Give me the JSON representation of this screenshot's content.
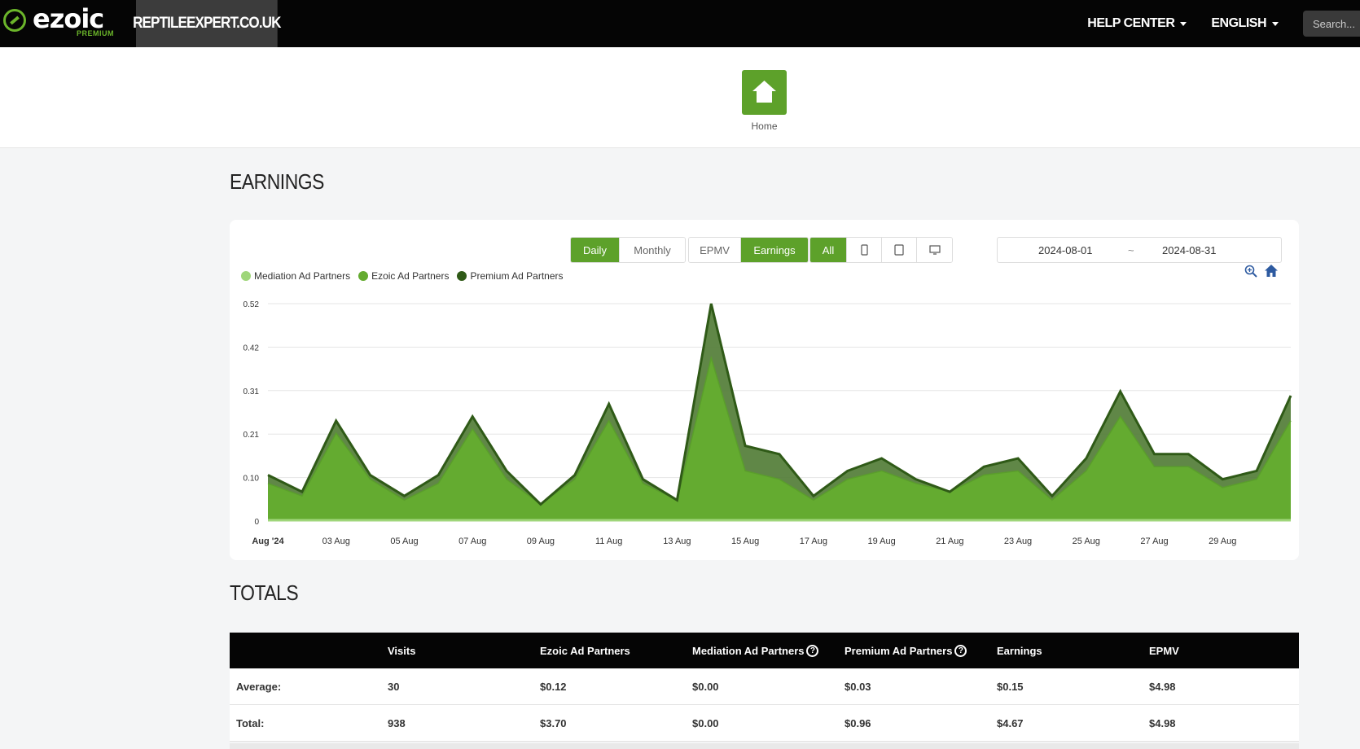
{
  "nav": {
    "logo_text": "ezoic",
    "logo_sub": "PREMIUM",
    "site": "REPTILEEXPERT.CO.UK",
    "help_center": "HELP CENTER",
    "language": "ENGLISH",
    "search_placeholder": "Search..."
  },
  "home": {
    "label": "Home"
  },
  "earnings": {
    "title": "EARNINGS",
    "period_buttons": [
      "Daily",
      "Monthly"
    ],
    "metric_buttons": [
      "EPMV",
      "Earnings"
    ],
    "device_all": "All",
    "device_icons": [
      "mobile-icon",
      "tablet-icon",
      "desktop-icon"
    ],
    "date_from": "2024-08-01",
    "date_sep": "~",
    "date_to": "2024-08-31"
  },
  "colors": {
    "accent": "#5da12a",
    "mediation": "#9fd67a",
    "ezoic": "#64ab30",
    "premium": "#3c6b21"
  },
  "chart_data": {
    "type": "area",
    "stacked": true,
    "x": [
      "Aug '24",
      "02 Aug",
      "03 Aug",
      "04 Aug",
      "05 Aug",
      "06 Aug",
      "07 Aug",
      "08 Aug",
      "09 Aug",
      "10 Aug",
      "11 Aug",
      "12 Aug",
      "13 Aug",
      "14 Aug",
      "15 Aug",
      "16 Aug",
      "17 Aug",
      "18 Aug",
      "19 Aug",
      "20 Aug",
      "21 Aug",
      "22 Aug",
      "23 Aug",
      "24 Aug",
      "25 Aug",
      "26 Aug",
      "27 Aug",
      "28 Aug",
      "29 Aug",
      "30 Aug",
      "31 Aug"
    ],
    "x_tick_labels": [
      "Aug '24",
      "03 Aug",
      "05 Aug",
      "07 Aug",
      "09 Aug",
      "11 Aug",
      "13 Aug",
      "15 Aug",
      "17 Aug",
      "19 Aug",
      "21 Aug",
      "23 Aug",
      "25 Aug",
      "27 Aug",
      "29 Aug"
    ],
    "y_tick_labels": [
      "0",
      "0.10",
      "0.21",
      "0.31",
      "0.42",
      "0.52"
    ],
    "ylim": [
      0,
      0.52
    ],
    "series": [
      {
        "name": "Mediation Ad Partners",
        "values": [
          0,
          0,
          0,
          0,
          0,
          0,
          0,
          0,
          0,
          0,
          0,
          0,
          0,
          0,
          0,
          0,
          0,
          0,
          0,
          0,
          0,
          0,
          0,
          0,
          0,
          0,
          0,
          0,
          0,
          0,
          0
        ]
      },
      {
        "name": "Ezoic Ad Partners",
        "values": [
          0.09,
          0.06,
          0.21,
          0.1,
          0.05,
          0.09,
          0.22,
          0.1,
          0.04,
          0.1,
          0.24,
          0.09,
          0.05,
          0.39,
          0.12,
          0.1,
          0.05,
          0.1,
          0.12,
          0.09,
          0.07,
          0.11,
          0.12,
          0.05,
          0.12,
          0.25,
          0.13,
          0.13,
          0.08,
          0.1,
          0.24
        ]
      },
      {
        "name": "Premium Ad Partners",
        "values": [
          0.02,
          0.01,
          0.03,
          0.01,
          0.01,
          0.02,
          0.03,
          0.02,
          0.0,
          0.01,
          0.04,
          0.01,
          0.0,
          0.13,
          0.06,
          0.06,
          0.01,
          0.02,
          0.03,
          0.01,
          0.0,
          0.02,
          0.03,
          0.01,
          0.03,
          0.06,
          0.03,
          0.03,
          0.02,
          0.02,
          0.06
        ]
      }
    ]
  },
  "totals": {
    "title": "TOTALS",
    "headers": [
      "",
      "Visits",
      "Ezoic Ad Partners",
      "Mediation Ad Partners",
      "Premium Ad Partners",
      "Earnings",
      "EPMV"
    ],
    "help_mark": "?",
    "rows": [
      [
        "Average:",
        "30",
        "$0.12",
        "$0.00",
        "$0.03",
        "$0.15",
        "$4.98"
      ],
      [
        "Total:",
        "938",
        "$3.70",
        "$0.00",
        "$0.96",
        "$4.67",
        "$4.98"
      ]
    ]
  }
}
